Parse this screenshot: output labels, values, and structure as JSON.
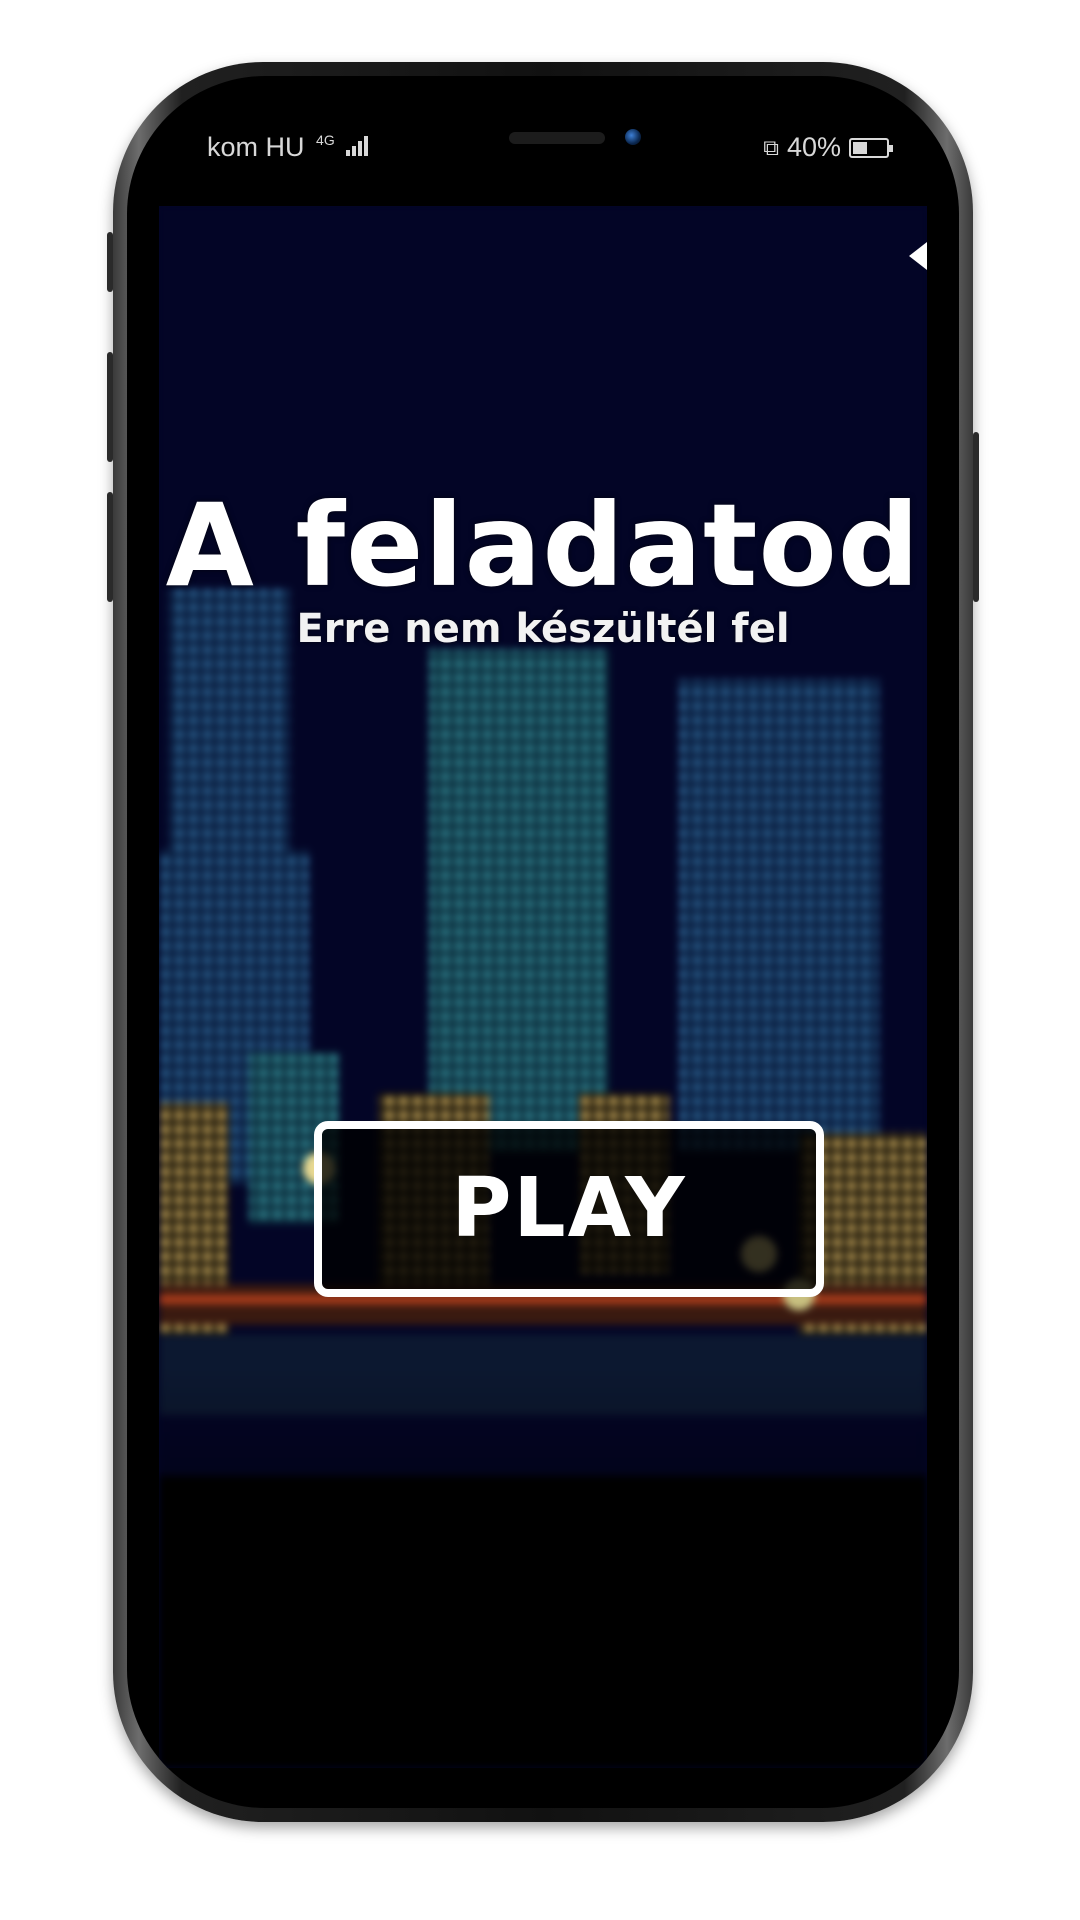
{
  "status_bar": {
    "carrier": "kom HU",
    "network": "4G",
    "battery": "40%",
    "icons": [
      "signal-icon",
      "nfc-icon",
      "battery-icon"
    ]
  },
  "game": {
    "title": "A feladatod",
    "subtitle": "Erre nem készültél fel",
    "play_label": "PLAY",
    "background": "pixel-city-skyline-night",
    "colors": {
      "sky": "#030526",
      "text": "#ffffff",
      "button_border": "#ffffff"
    }
  },
  "navigation": {
    "back_icon": "back-arrow-icon"
  }
}
